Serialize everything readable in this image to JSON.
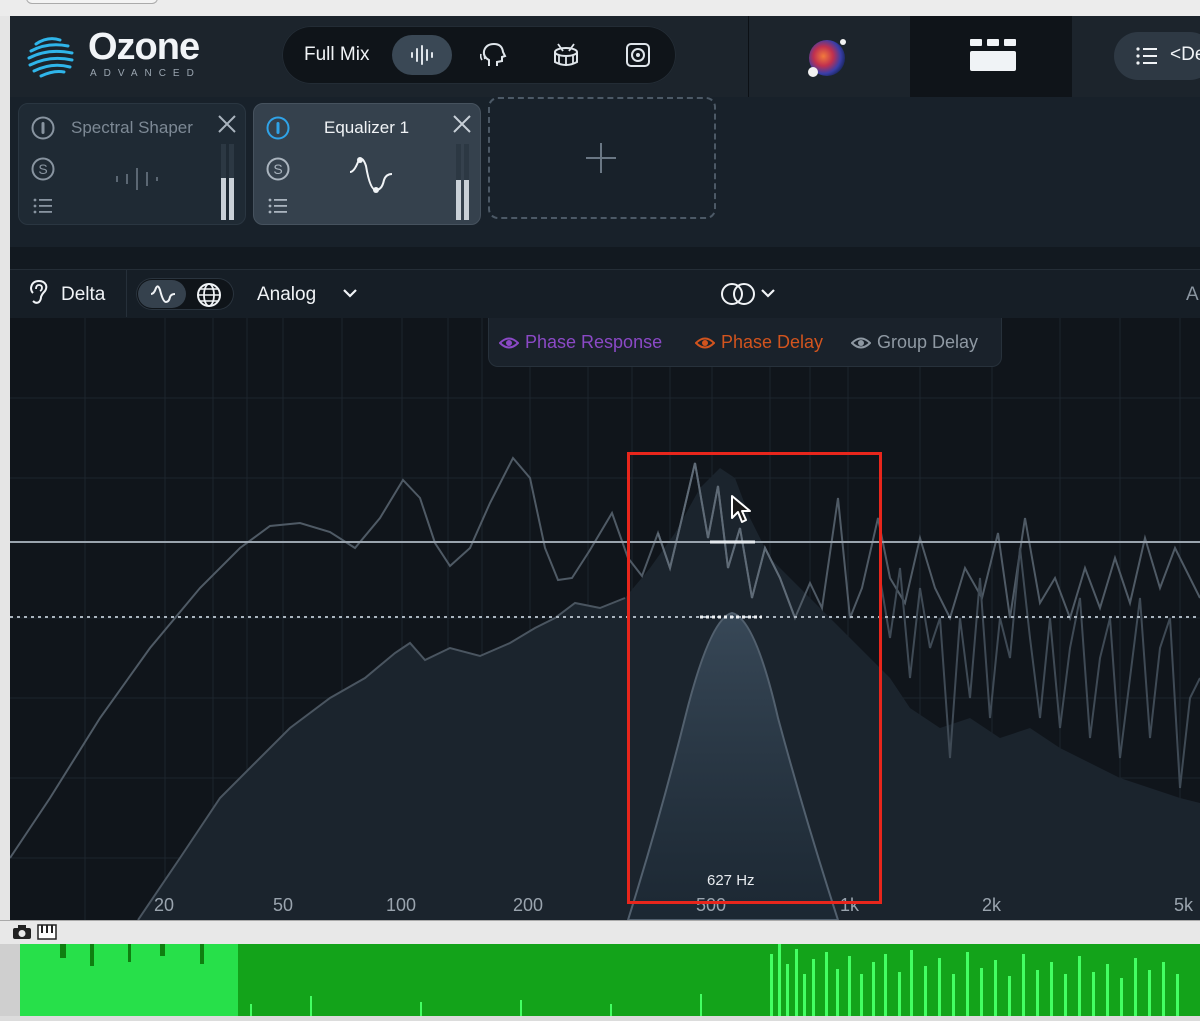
{
  "header": {
    "logo_title": "Ozone",
    "logo_subtitle": "ADVANCED",
    "mix_label": "Full Mix",
    "preset_text": "<De"
  },
  "modules": [
    {
      "name": "Spectral Shaper",
      "active": false
    },
    {
      "name": "Equalizer 1",
      "active": true
    }
  ],
  "toolbar": {
    "delta_label": "Delta",
    "mode_label": "Analog",
    "edge_text": "A"
  },
  "legend": {
    "phase_response": "Phase Response",
    "phase_delay": "Phase Delay",
    "group_delay": "Group Delay"
  },
  "graph": {
    "band_frequency": "627 Hz",
    "freq_labels": [
      "20",
      "50",
      "100",
      "200",
      "500",
      "1k",
      "2k",
      "5k"
    ]
  },
  "colors": {
    "accent_blue": "#2fa3e8",
    "phase_response": "#8b49c6",
    "phase_delay": "#d2541e",
    "group_delay": "#8f99a3",
    "highlight": "#e8261c",
    "track_green": "#27e04a"
  }
}
